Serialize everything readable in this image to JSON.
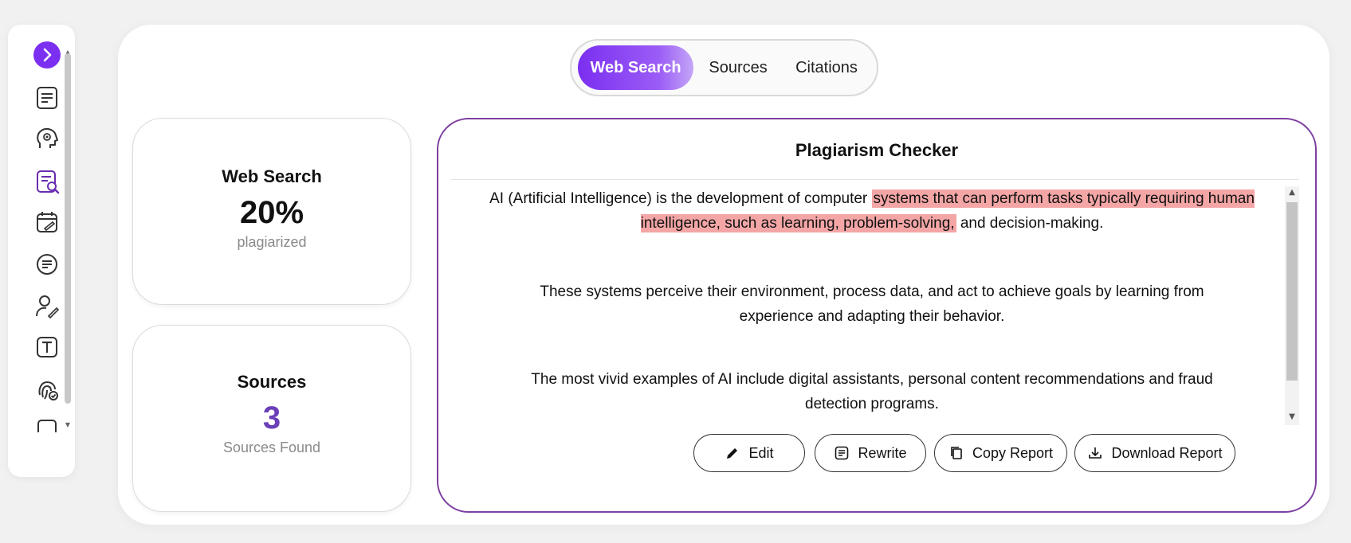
{
  "sidebar": {
    "items": [
      {
        "icon": "chevron-right-icon"
      },
      {
        "icon": "document-lines-icon"
      },
      {
        "icon": "brain-head-icon"
      },
      {
        "icon": "plagiarism-check-icon"
      },
      {
        "icon": "calendar-edit-icon"
      },
      {
        "icon": "summary-icon"
      },
      {
        "icon": "user-pen-icon"
      },
      {
        "icon": "text-box-icon"
      },
      {
        "icon": "fingerprint-check-icon"
      }
    ],
    "accent": "#7b2ff0"
  },
  "tabs": {
    "web_search": "Web Search",
    "sources": "Sources",
    "citations": "Citations",
    "active": "Web Search"
  },
  "web_search_card": {
    "title": "Web Search",
    "value": "20%",
    "label": "plagiarized"
  },
  "sources_card": {
    "title": "Sources",
    "value": "3",
    "label": "Sources Found"
  },
  "checker": {
    "title": "Plagiarism Checker",
    "p1_plain_a": "AI (Artificial Intelligence) is the development of computer ",
    "p1_highlight": "systems that can perform tasks typically requiring human intelligence, such as learning, problem-solving,",
    "p1_plain_b": " and decision-making.",
    "p2": "These systems perceive their environment, process data, and act to achieve goals by learning from experience and adapting their behavior.",
    "p3": "The most vivid examples of AI include digital assistants, personal content recommendations and fraud detection programs.",
    "highlight_color": "#f4a6a6"
  },
  "actions": {
    "edit": "Edit",
    "rewrite": "Rewrite",
    "copy_report": "Copy Report",
    "download_report": "Download Report"
  }
}
